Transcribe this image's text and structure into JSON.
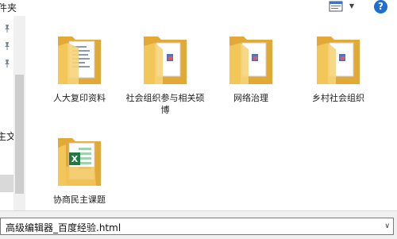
{
  "window": {
    "title": "件夹"
  },
  "toolbar": {
    "view_icon": "view-options-icon",
    "dropdown_icon": "chevron-down-icon",
    "help_label": "?"
  },
  "sidebar": {
    "partial_text": "主文"
  },
  "folders": [
    {
      "label": "人大复印资料",
      "icon": "folder-with-documents-icon"
    },
    {
      "label": "社会组织参与相关硕博",
      "icon": "folder-with-pdf-icon"
    },
    {
      "label": "网络治理",
      "icon": "folder-with-pdf-icon"
    },
    {
      "label": "乡村社会组织",
      "icon": "folder-with-pdf-icon"
    },
    {
      "label": "协商民主课题",
      "icon": "folder-with-excel-icon"
    }
  ],
  "filename": {
    "value": "高级编辑器_百度经验.html"
  },
  "colors": {
    "folder": "#f3c65a",
    "folder_dark": "#e2a937",
    "help": "#1f6fce",
    "excel": "#1d7a45"
  }
}
